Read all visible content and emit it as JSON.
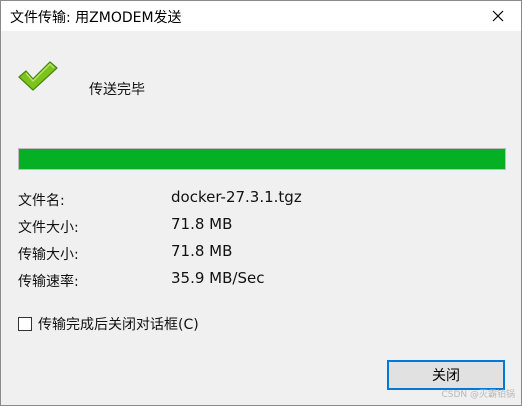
{
  "window": {
    "title": "文件传输: 用ZMODEM发送",
    "close_icon": "close-icon"
  },
  "status": {
    "icon": "checkmark-icon",
    "text": "传送完毕"
  },
  "progress": {
    "percent": 100,
    "color": "#06b025"
  },
  "info": {
    "rows": [
      {
        "label": "文件名:",
        "value": "docker-27.3.1.tgz"
      },
      {
        "label": "文件大小:",
        "value": "71.8 MB"
      },
      {
        "label": "传输大小:",
        "value": "71.8 MB"
      },
      {
        "label": "传输速率:",
        "value": "35.9 MB/Sec"
      }
    ]
  },
  "options": {
    "close_after_label": "传输完成后关闭对话框(C)",
    "close_after_checked": false
  },
  "actions": {
    "close_label": "关闭"
  },
  "watermark": "CSDN @灭霸铂锅",
  "colors": {
    "accent": "#0078d7",
    "success": "#06b025",
    "check_green": "#7cc41c"
  }
}
